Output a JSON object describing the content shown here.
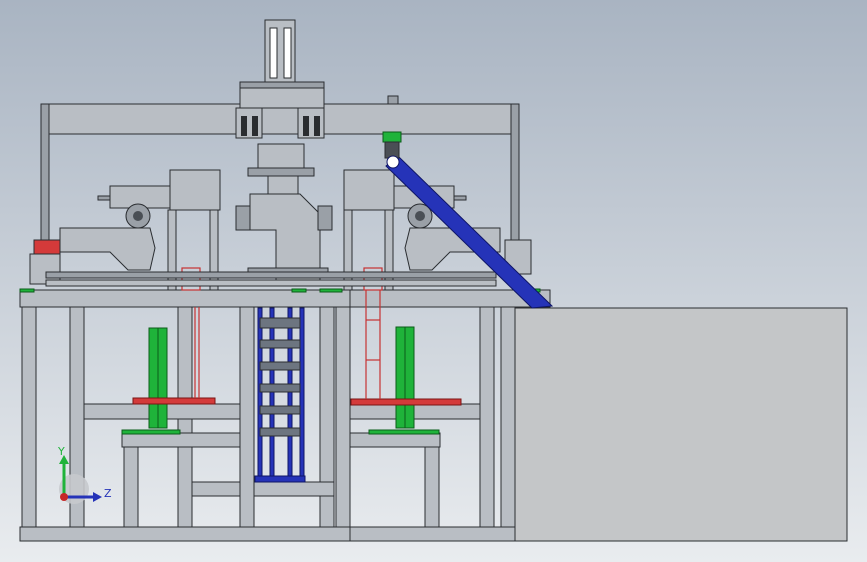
{
  "view": {
    "background_top": "#a9b4c2",
    "background_bottom": "#e9ecef",
    "frame_color": "#b9bec4",
    "blue_part_color": "#2533b8",
    "green_part_color": "#1fb33a",
    "red_part_color": "#d43a3a"
  },
  "triad": {
    "y_label": "Y",
    "z_label": "Z",
    "y_color": "#1fb33a",
    "z_color": "#2533b8",
    "origin_color": "#c62828"
  }
}
